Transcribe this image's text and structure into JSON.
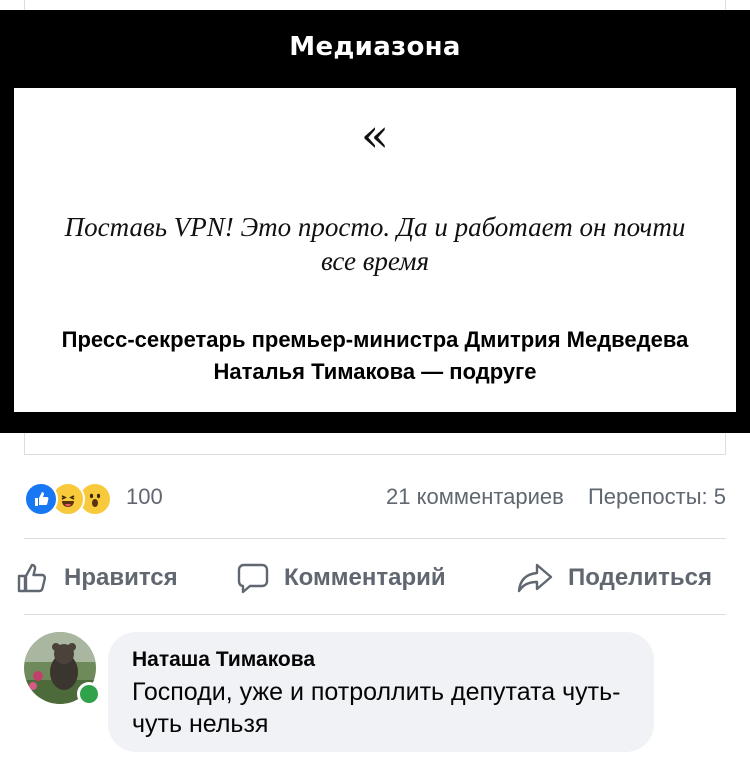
{
  "post_image": {
    "brand": "Медиазона",
    "quote_mark": "«",
    "quote_text": "Поставь VPN! Это просто. Да и работает он почти все время",
    "attribution": "Пресс-секретарь премьер-министра Дмитрия Медведева Наталья Тимакова — подруге"
  },
  "reactions": {
    "icons": [
      "like-icon",
      "haha-icon",
      "wow-icon"
    ],
    "count": "100"
  },
  "stats": {
    "comments": "21 комментариев",
    "shares": "Перепосты: 5"
  },
  "actions": {
    "like_label": "Нравится",
    "comment_label": "Комментарий",
    "share_label": "Поделиться"
  },
  "comment": {
    "author": "Наташа Тимакова",
    "text": "Господи, уже и потроллить депутата чуть-чуть нельзя",
    "online": true
  },
  "colors": {
    "card_background": "#000000",
    "like_blue": "#1877f2",
    "reaction_yellow": "#f7c93b",
    "muted_text": "#606770",
    "online_green": "#31a24c",
    "bubble_background": "#f0f2f5"
  }
}
